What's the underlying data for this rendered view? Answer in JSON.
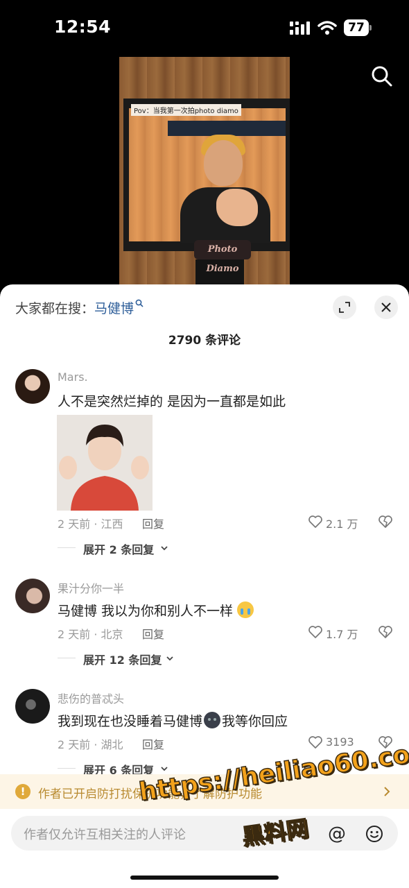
{
  "status_bar": {
    "time": "12:54",
    "battery": "77"
  },
  "video": {
    "caption": "Pov：当我第一次拍photo diamo",
    "logo": "Photo Diamo"
  },
  "hot_search": {
    "prefix": "大家都在搜：",
    "keyword": "马健博"
  },
  "comment_count": "2790 条评论",
  "comments": [
    {
      "user": "Mars.",
      "text": "人不是突然烂掉的 是因为一直都是如此",
      "meta": "2 天前 · 江西",
      "reply": "回复",
      "likes": "2.1 万",
      "expand": "展开 2 条回复"
    },
    {
      "user": "果汁分你一半",
      "text": "马健博 我以为你和别人不一样",
      "meta": "2 天前 · 北京",
      "reply": "回复",
      "likes": "1.7 万",
      "expand": "展开 12 条回复"
    },
    {
      "user": "悲伤的普忒头",
      "text_before": "我到现在也没睡着马健博",
      "text_after": "我等你回应",
      "meta": "2 天前 · 湖北",
      "reply": "回复",
      "likes": "3193",
      "expand": "展开 6 条回复"
    }
  ],
  "protection": {
    "text": "作者已开启防打扰保护功能，了解防护功能"
  },
  "input": {
    "placeholder": "作者仅允许互相关注的人评论"
  },
  "watermark": {
    "line1": "https://heiliao60.com",
    "line2": "黑料网"
  },
  "colors": {
    "sheet_bg": "#ffffff",
    "keyword": "#2f5f9a",
    "protect_bg": "#fdf5e6",
    "protect_text": "#b88a2f",
    "watermark": "#f3a21b"
  },
  "icons": [
    "signal-icon",
    "wifi-icon",
    "battery-icon",
    "search-icon",
    "expand-icon",
    "close-icon",
    "heart-icon",
    "broken-heart-icon",
    "chevron-down-icon",
    "warning-icon",
    "chevron-right-icon",
    "at-icon",
    "smiley-icon"
  ]
}
